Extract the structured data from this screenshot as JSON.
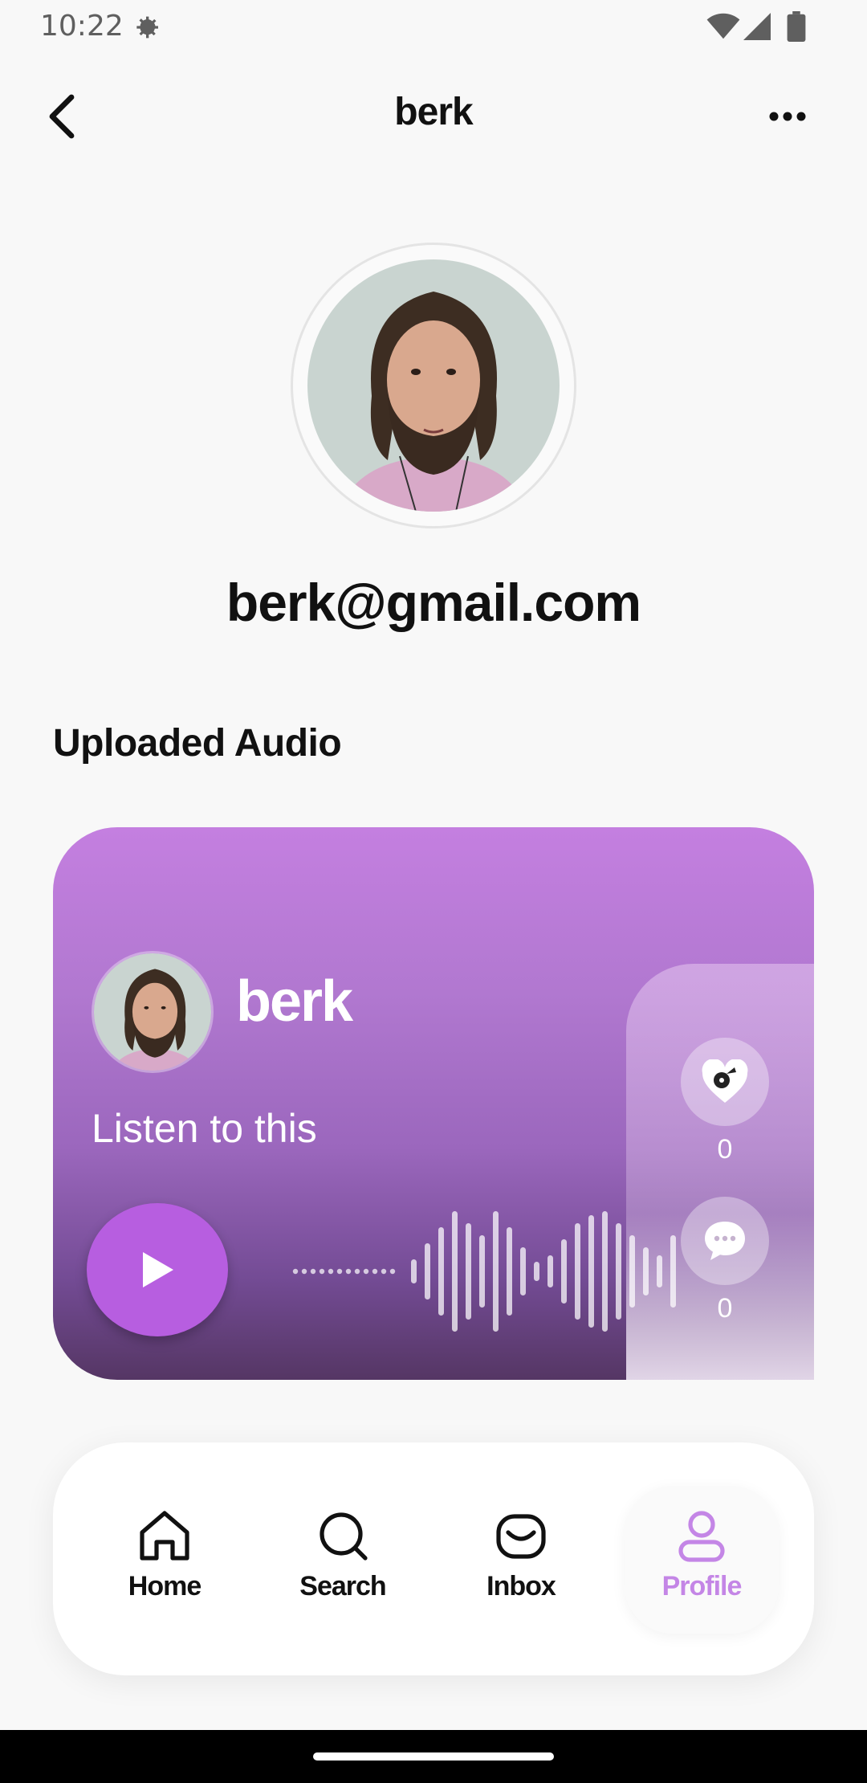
{
  "status_bar": {
    "time": "10:22"
  },
  "header": {
    "title": "berk"
  },
  "profile": {
    "email": "berk@gmail.com"
  },
  "section": {
    "title": "Uploaded Audio"
  },
  "audio_card": {
    "username": "berk",
    "caption": "Listen to this",
    "likes": "0",
    "comments": "0",
    "accent_color": "#b75ee0"
  },
  "bottom_nav": {
    "items": [
      {
        "label": "Home",
        "icon": "home-icon"
      },
      {
        "label": "Search",
        "icon": "search-icon"
      },
      {
        "label": "Inbox",
        "icon": "inbox-icon"
      },
      {
        "label": "Profile",
        "icon": "profile-icon",
        "active": true
      }
    ],
    "active_color": "#c486e6"
  }
}
